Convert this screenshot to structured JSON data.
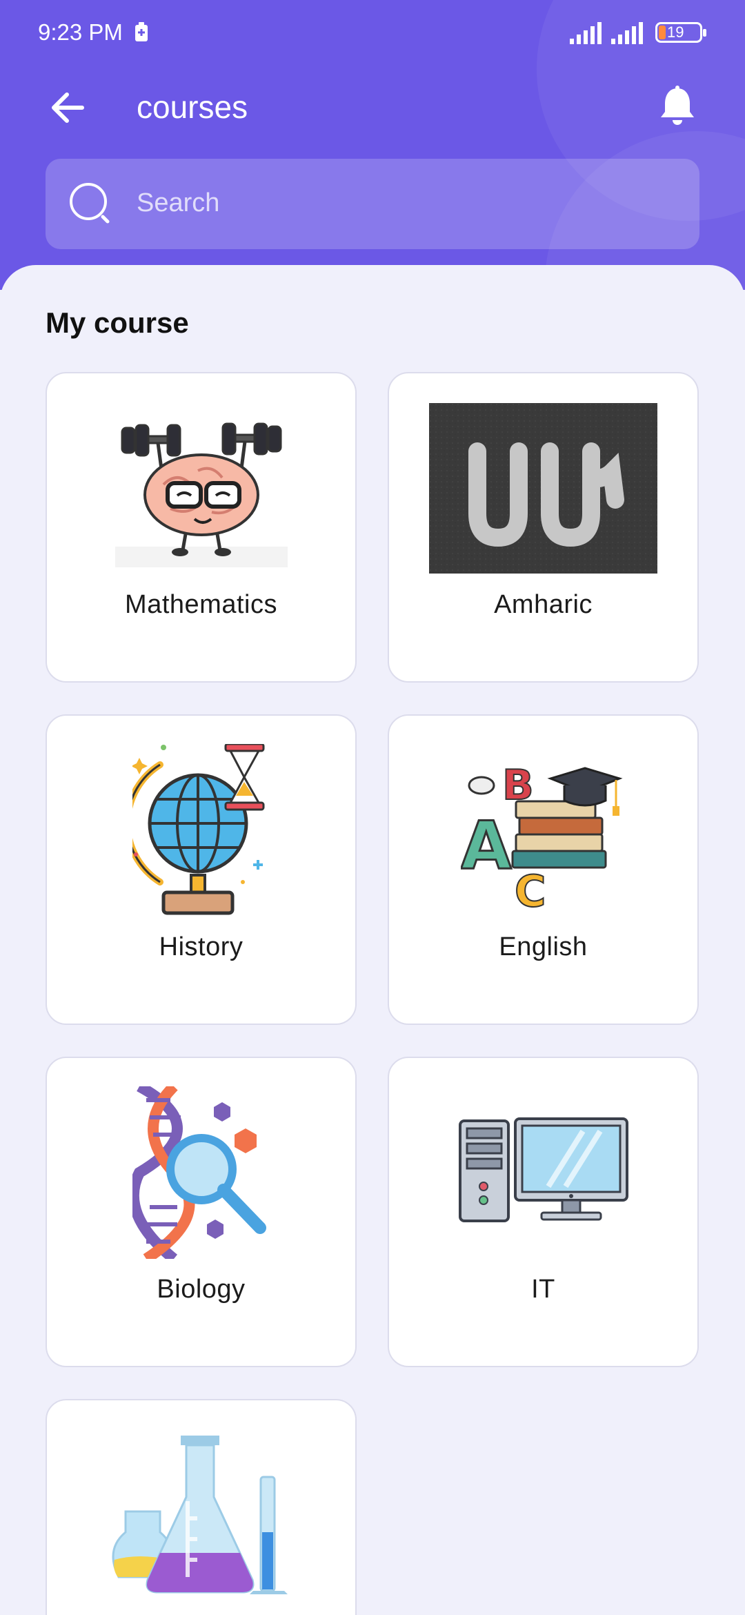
{
  "status_bar": {
    "time": "9:23 PM",
    "battery_level": "19"
  },
  "toolbar": {
    "title": "courses"
  },
  "search": {
    "placeholder": "Search"
  },
  "section": {
    "title": "My course"
  },
  "courses": [
    {
      "label": "Mathematics",
      "icon": "brain-lifting-weights-icon"
    },
    {
      "label": "Amharic",
      "icon": "amharic-letters-chalkboard-icon"
    },
    {
      "label": "History",
      "icon": "globe-hourglass-icon"
    },
    {
      "label": "English",
      "icon": "abc-books-graduation-cap-icon"
    },
    {
      "label": "Biology",
      "icon": "dna-magnifier-icon"
    },
    {
      "label": "IT",
      "icon": "desktop-computer-icon"
    },
    {
      "label": "",
      "icon": "chemistry-flasks-icon"
    }
  ],
  "colors": {
    "primary": "#6b58e6",
    "background": "#f0f0fb",
    "card": "#ffffff"
  }
}
